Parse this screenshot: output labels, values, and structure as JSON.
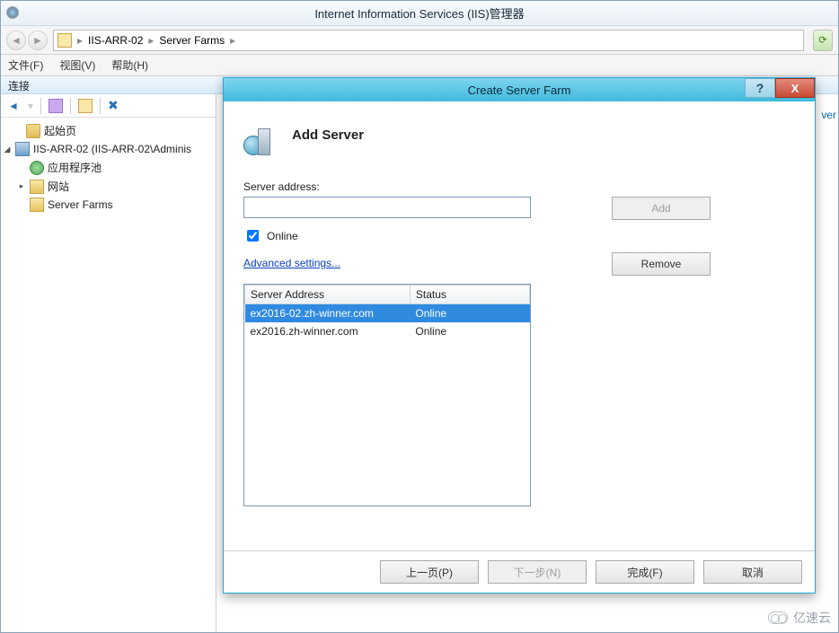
{
  "window": {
    "title": "Internet Information Services (IIS)管理器"
  },
  "breadcrumb": {
    "seg1": "IIS-ARR-02",
    "seg2": "Server Farms"
  },
  "menu": {
    "file": "文件(F)",
    "view": "视图(V)",
    "help": "帮助(H)"
  },
  "panel": {
    "connections": "连接"
  },
  "tree": {
    "start": "起始页",
    "node": "IIS-ARR-02 (IIS-ARR-02\\Adminis",
    "pool": "应用程序池",
    "sites": "网站",
    "farms": "Server Farms"
  },
  "right_cut": "ver",
  "dialog": {
    "title": "Create Server Farm",
    "heading": "Add Server",
    "server_address_label": "Server address:",
    "server_address_value": "",
    "online_label": "Online",
    "online_checked": true,
    "advanced": "Advanced settings...",
    "add_btn": "Add",
    "remove_btn": "Remove",
    "columns": {
      "c1": "Server Address",
      "c2": "Status"
    },
    "rows": [
      {
        "addr": "ex2016-02.zh-winner.com",
        "status": "Online",
        "selected": true
      },
      {
        "addr": "ex2016.zh-winner.com",
        "status": "Online",
        "selected": false
      }
    ],
    "prev": "上一页(P)",
    "next": "下一步(N)",
    "finish": "完成(F)",
    "cancel": "取消"
  },
  "watermark": "亿速云"
}
